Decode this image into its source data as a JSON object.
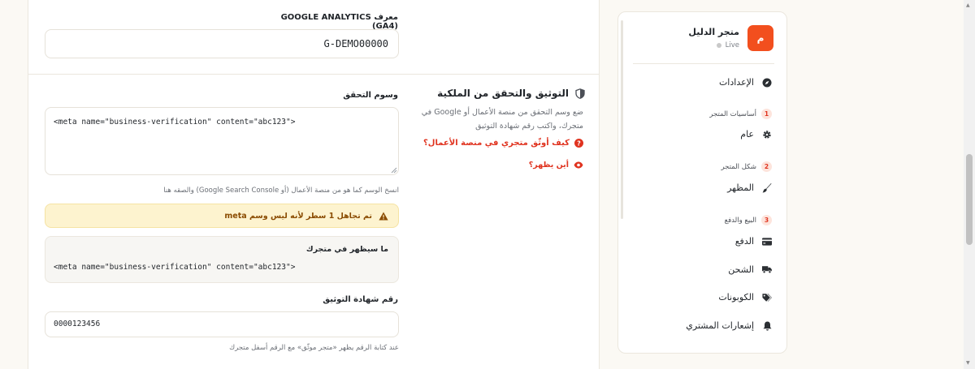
{
  "analytics": {
    "label": "معرف GOOGLE ANALYTICS (GA4)",
    "value": "G-DEMO00000"
  },
  "verification": {
    "title": "التوثيق والتحقق من الملكية",
    "description": "ضع وسم التحقق من منصة الأعمال أو Google في متجرك، واكتب رقم شهادة التوثيق",
    "help_link": "كيف أوثّق متجري في منصة الأعمال؟",
    "where_link": "أين يظهر؟",
    "tags_label": "وسوم التحقق",
    "tags_value": "<meta name=\"business-verification\" content=\"abc123\">",
    "tags_hint": "انسخ الوسم كما هو من منصة الأعمال (أو Google Search Console) والصقه هنا",
    "warning": "تم تجاهل 1 سطر لأنه ليس وسم meta",
    "preview_title": "ما سيظهر في متجرك",
    "preview_code": "<meta name=\"business-verification\" content=\"abc123\">",
    "cert_label": "رقم شهادة التوثيق",
    "cert_value": "0000123456",
    "cert_hint": "عند كتابة الرقم يظهر «متجر موثّق» مع الرقم أسفل متجرك"
  },
  "sidebar": {
    "store_logo": "م",
    "store_name": "متجر الدليل",
    "store_status": "Live",
    "settings": "الإعدادات",
    "groups": [
      {
        "num": "1",
        "label": "أساسيات المتجر"
      },
      {
        "num": "2",
        "label": "شكل المتجر"
      },
      {
        "num": "3",
        "label": "البيع والدفع"
      }
    ],
    "items": {
      "general": "عام",
      "appearance": "المظهر",
      "payment": "الدفع",
      "shipping": "الشحن",
      "coupons": "الكوبونات",
      "notifications": "إشعارات المشتري"
    }
  },
  "colors": {
    "accent": "#e0331f",
    "logo_bg": "#f24f1e",
    "warning_bg": "#fdf3cf",
    "warning_text": "#8a4b00"
  }
}
